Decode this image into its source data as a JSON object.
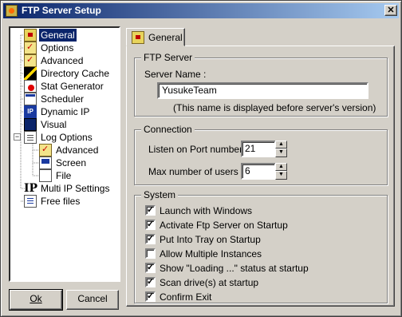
{
  "window": {
    "title": "FTP Server Setup",
    "close_glyph": "✕"
  },
  "tree": {
    "items": [
      {
        "label": "General",
        "icon": "folder-icon",
        "selected": true
      },
      {
        "label": "Options",
        "icon": "options-icon"
      },
      {
        "label": "Advanced",
        "icon": "advanced-icon"
      },
      {
        "label": "Directory Cache",
        "icon": "directory-cache-icon"
      },
      {
        "label": "Stat Generator",
        "icon": "stat-generator-icon"
      },
      {
        "label": "Scheduler",
        "icon": "scheduler-icon"
      },
      {
        "label": "Dynamic IP",
        "icon": "dynamic-ip-icon"
      },
      {
        "label": "Visual",
        "icon": "visual-icon"
      },
      {
        "label": "Log Options",
        "icon": "log-options-icon",
        "expanded": true
      },
      {
        "label": "Advanced",
        "icon": "advanced-icon"
      },
      {
        "label": "Screen",
        "icon": "screen-icon"
      },
      {
        "label": "File",
        "icon": "file-icon"
      },
      {
        "label": "Multi IP Settings",
        "icon": "multi-ip-icon"
      },
      {
        "label": "Free files",
        "icon": "free-files-icon"
      }
    ],
    "expander_glyph": "−",
    "multi_ip_glyph": "IP",
    "dynamic_ip_glyph": "IP"
  },
  "buttons": {
    "ok": "Ok",
    "cancel": "Cancel"
  },
  "tab": {
    "label": "General"
  },
  "ftp_server": {
    "group_title": "FTP Server",
    "server_name_label": "Server Name :",
    "server_name_value": "YusukeTeam",
    "hint": "(This name is displayed before server's version)"
  },
  "connection": {
    "group_title": "Connection",
    "port_label": "Listen on Port number :",
    "port_value": "21",
    "max_users_label": "Max number of users :",
    "max_users_value": "6",
    "spin_up": "▲",
    "spin_down": "▼"
  },
  "system": {
    "group_title": "System",
    "check_glyph": "✓",
    "options": [
      {
        "label": "Launch with Windows",
        "checked": true
      },
      {
        "label": "Activate Ftp Server on Startup",
        "checked": true
      },
      {
        "label": "Put Into Tray on Startup",
        "checked": true
      },
      {
        "label": "Allow Multiple Instances",
        "checked": false
      },
      {
        "label": "Show \"Loading ...\" status at startup",
        "checked": true
      },
      {
        "label": "Scan drive(s) at startup",
        "checked": true
      },
      {
        "label": "Confirm Exit",
        "checked": true
      }
    ]
  }
}
